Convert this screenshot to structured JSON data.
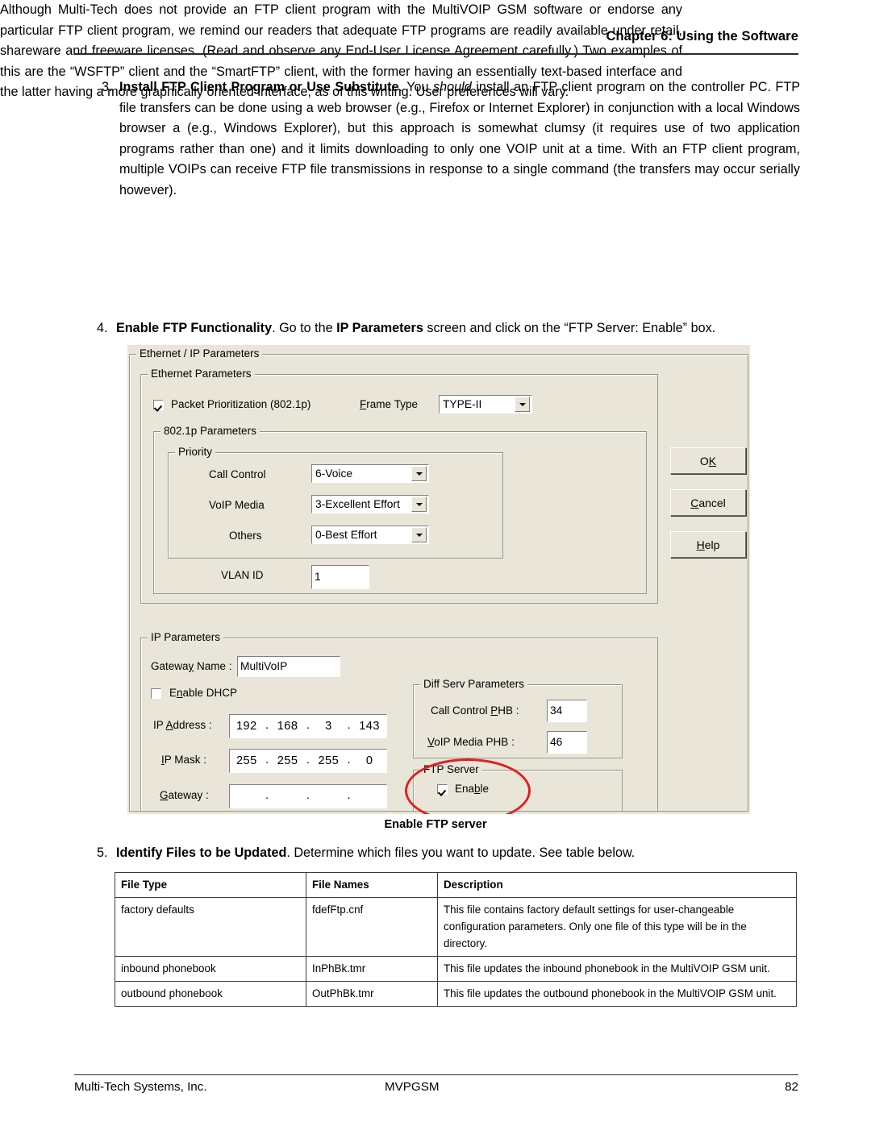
{
  "header": {
    "chapter": "Chapter 6: Using the Software"
  },
  "steps": {
    "step3": {
      "number": "3.",
      "title": "Install FTP Client Program or Use Substitute",
      "body_pre": ".  You ",
      "emphasis": "should",
      "body": " install an FTP client program on the controller PC.  FTP file transfers can be done using a web browser (e.g., Firefox or Internet Explorer) in conjunction with a local Windows browser a (e.g., Windows Explorer), but this approach is somewhat clumsy (it requires use of two application programs rather than one) and it limits downloading to only one VOIP unit at a time.  With an FTP client program, multiple VOIPs can receive FTP file transmissions in response to a single command (the transfers may occur serially however)."
    },
    "paragraph2": "Although Multi-Tech does not provide an FTP client program with the MultiVOIP GSM software or endorse any particular FTP client program, we remind our readers that adequate FTP programs are readily available under retail, shareware and freeware licenses.  (Read and observe any End-User License Agreement carefully.)  Two examples of this are the “WSFTP” client and the “SmartFTP” client, with the former having an essentially text-based interface and the latter having a more graphically oriented interface, as of this writing.  User preferences will vary.",
    "step4": {
      "number": "4.",
      "title": "Enable FTP Functionality",
      "body_pre": ".  Go to the ",
      "bold_mid": "IP Parameters",
      "body_post": " screen and click on the “FTP Server: Enable” box."
    },
    "step5": {
      "number": "5.",
      "title": "Identify Files to be Updated",
      "body": ".  Determine which files you want to update.  See table below."
    }
  },
  "figure_caption": "Enable FTP server",
  "dialog": {
    "outer_group_title": "Ethernet / IP Parameters",
    "ethernet_group": {
      "title": "Ethernet Parameters",
      "packet_prioritization_label": "Packet Prioritization (802.1p)",
      "packet_prioritization_checked": true,
      "frame_type_label": "Frame Type",
      "frame_type_value": "TYPE-II",
      "p8021p_group_title": "802.1p Parameters",
      "priority_group_title": "Priority",
      "priority_rows": [
        {
          "label": "Call Control",
          "value": "6-Voice"
        },
        {
          "label": "VoIP Media",
          "value": "3-Excellent Effort"
        },
        {
          "label": "Others",
          "value": "0-Best Effort"
        }
      ],
      "vlan_id_label": "VLAN ID",
      "vlan_id_value": "1"
    },
    "ip_group": {
      "title": "IP Parameters",
      "gateway_name_label": "Gateway Name :",
      "gateway_name_value": "MultiVoIP",
      "enable_dhcp_label": "Enable DHCP",
      "enable_dhcp_checked": false,
      "ip_address_label": "IP Address :",
      "ip_address": [
        "192",
        "168",
        "3",
        "143"
      ],
      "ip_mask_label": "IP Mask :",
      "ip_mask": [
        "255",
        "255",
        "255",
        "0"
      ],
      "gateway_label": "Gateway :",
      "gateway": [
        "",
        "",
        "",
        ""
      ]
    },
    "diffserv_group": {
      "title": "Diff Serv Parameters",
      "call_control_phb_label": "Call Control PHB :",
      "call_control_phb_value": "34",
      "voip_media_phb_label": "VoIP Media PHB :",
      "voip_media_phb_value": "46"
    },
    "ftp_group": {
      "title": "FTP Server",
      "enable_label": "Enable",
      "enable_checked": true
    },
    "buttons": {
      "ok": "OK",
      "cancel": "Cancel",
      "help": "Help"
    },
    "annotation_color": "#e02020",
    "background_color": "#E9E6D9"
  },
  "table": {
    "headers": [
      "File Type",
      "File Names",
      "Description"
    ],
    "rows": [
      {
        "file_type": "factory defaults",
        "file_name": "fdefFtp.cnf",
        "description": "This file contains factory default settings for user-changeable configuration parameters. Only one file of this type will be in the directory."
      },
      {
        "file_type": "inbound phonebook",
        "file_name": "InPhBk.tmr",
        "description": "This file updates the inbound phonebook in the MultiVOIP GSM unit."
      },
      {
        "file_type": "outbound phonebook",
        "file_name": "OutPhBk.tmr",
        "description": "This file updates the outbound phonebook in the MultiVOIP GSM unit."
      }
    ]
  },
  "footer": {
    "left": "Multi-Tech Systems, Inc.",
    "center": "MVPGSM",
    "page": "82"
  }
}
